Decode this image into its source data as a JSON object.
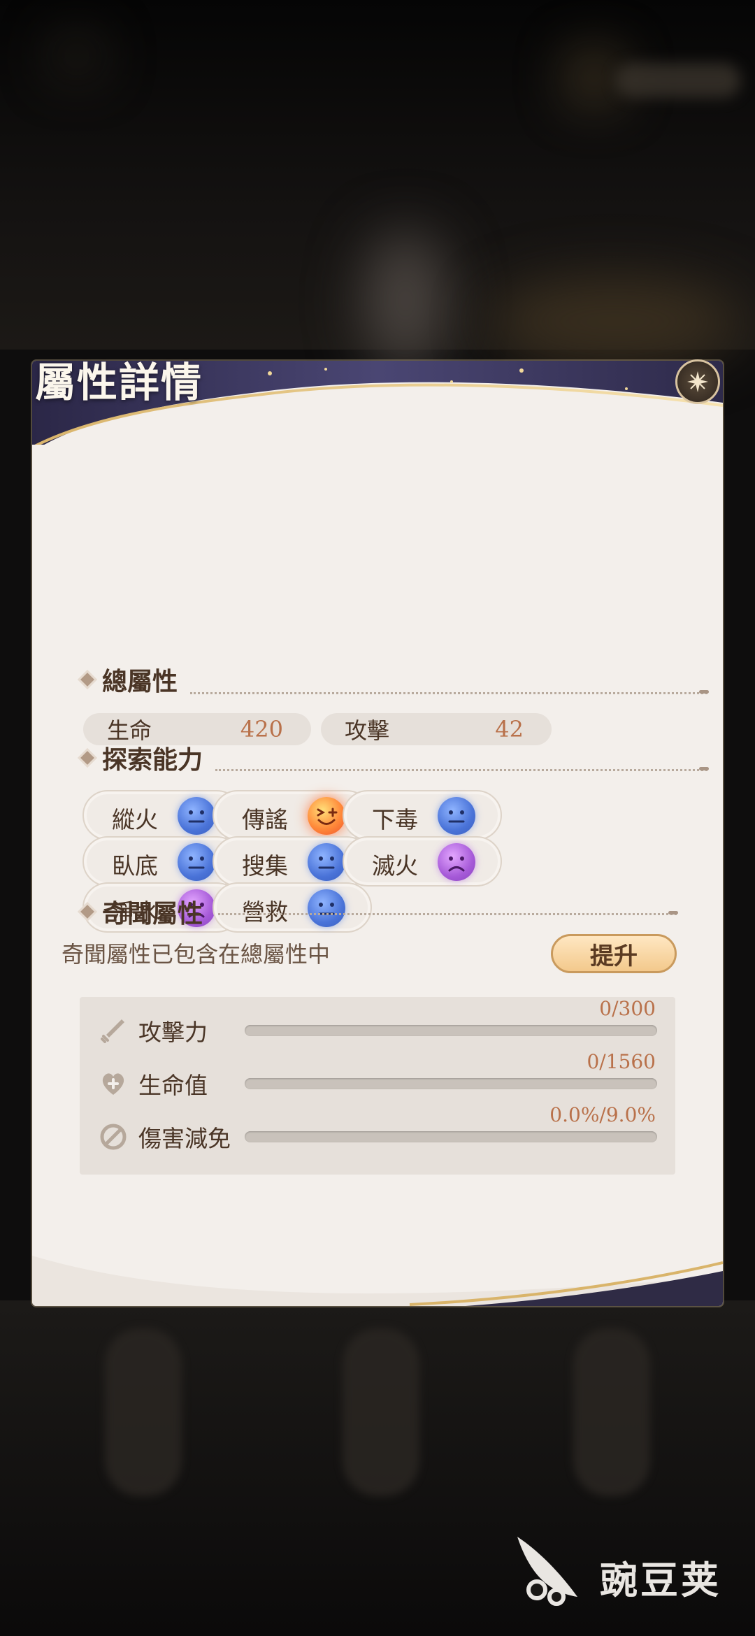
{
  "panel": {
    "title": "屬性詳情"
  },
  "total_attributes": {
    "title": "總屬性",
    "stats": [
      {
        "label": "生命",
        "value": "420"
      },
      {
        "label": "攻擊",
        "value": "42"
      }
    ]
  },
  "exploration": {
    "title": "探索能力",
    "abilities": [
      {
        "label": "縱火",
        "mood": "neutral",
        "color": "#4a73d8"
      },
      {
        "label": "傳謠",
        "mood": "happy",
        "color": "#ff8a3a"
      },
      {
        "label": "下毒",
        "mood": "neutral",
        "color": "#4a73d8"
      },
      {
        "label": "臥底",
        "mood": "neutral",
        "color": "#4a73d8"
      },
      {
        "label": "搜集",
        "mood": "neutral",
        "color": "#4a73d8"
      },
      {
        "label": "滅火",
        "mood": "sad",
        "color": "#a65ad8"
      },
      {
        "label": "淨水",
        "mood": "sad",
        "color": "#a65ad8"
      },
      {
        "label": "營救",
        "mood": "neutral",
        "color": "#4a73d8"
      }
    ]
  },
  "anecdote": {
    "title": "奇聞屬性",
    "description": "奇聞屬性已包含在總屬性中",
    "upgrade_label": "提升",
    "bonuses": [
      {
        "label": "攻擊力",
        "value": "0/300",
        "progress": 0.0,
        "icon": "sword-icon"
      },
      {
        "label": "生命值",
        "value": "0/1560",
        "progress": 0.0,
        "icon": "heart-plus-icon"
      },
      {
        "label": "傷害減免",
        "value": "0.0%/9.0%",
        "progress": 0.0,
        "icon": "shield-block-icon"
      }
    ]
  },
  "watermark": {
    "text": "豌豆荚"
  }
}
